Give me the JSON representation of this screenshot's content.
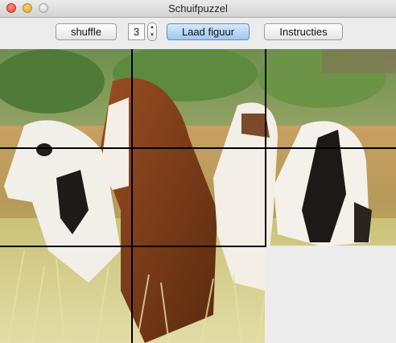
{
  "window": {
    "title": "Schuifpuzzel"
  },
  "toolbar": {
    "shuffle_label": "shuffle",
    "size_value": "3",
    "load_label": "Laad figuur",
    "instructions_label": "Instructies"
  },
  "puzzle": {
    "grid_size": 3,
    "empty_tile": {
      "row": 2,
      "col": 2
    },
    "image_subject": "horses running through a grass field"
  }
}
